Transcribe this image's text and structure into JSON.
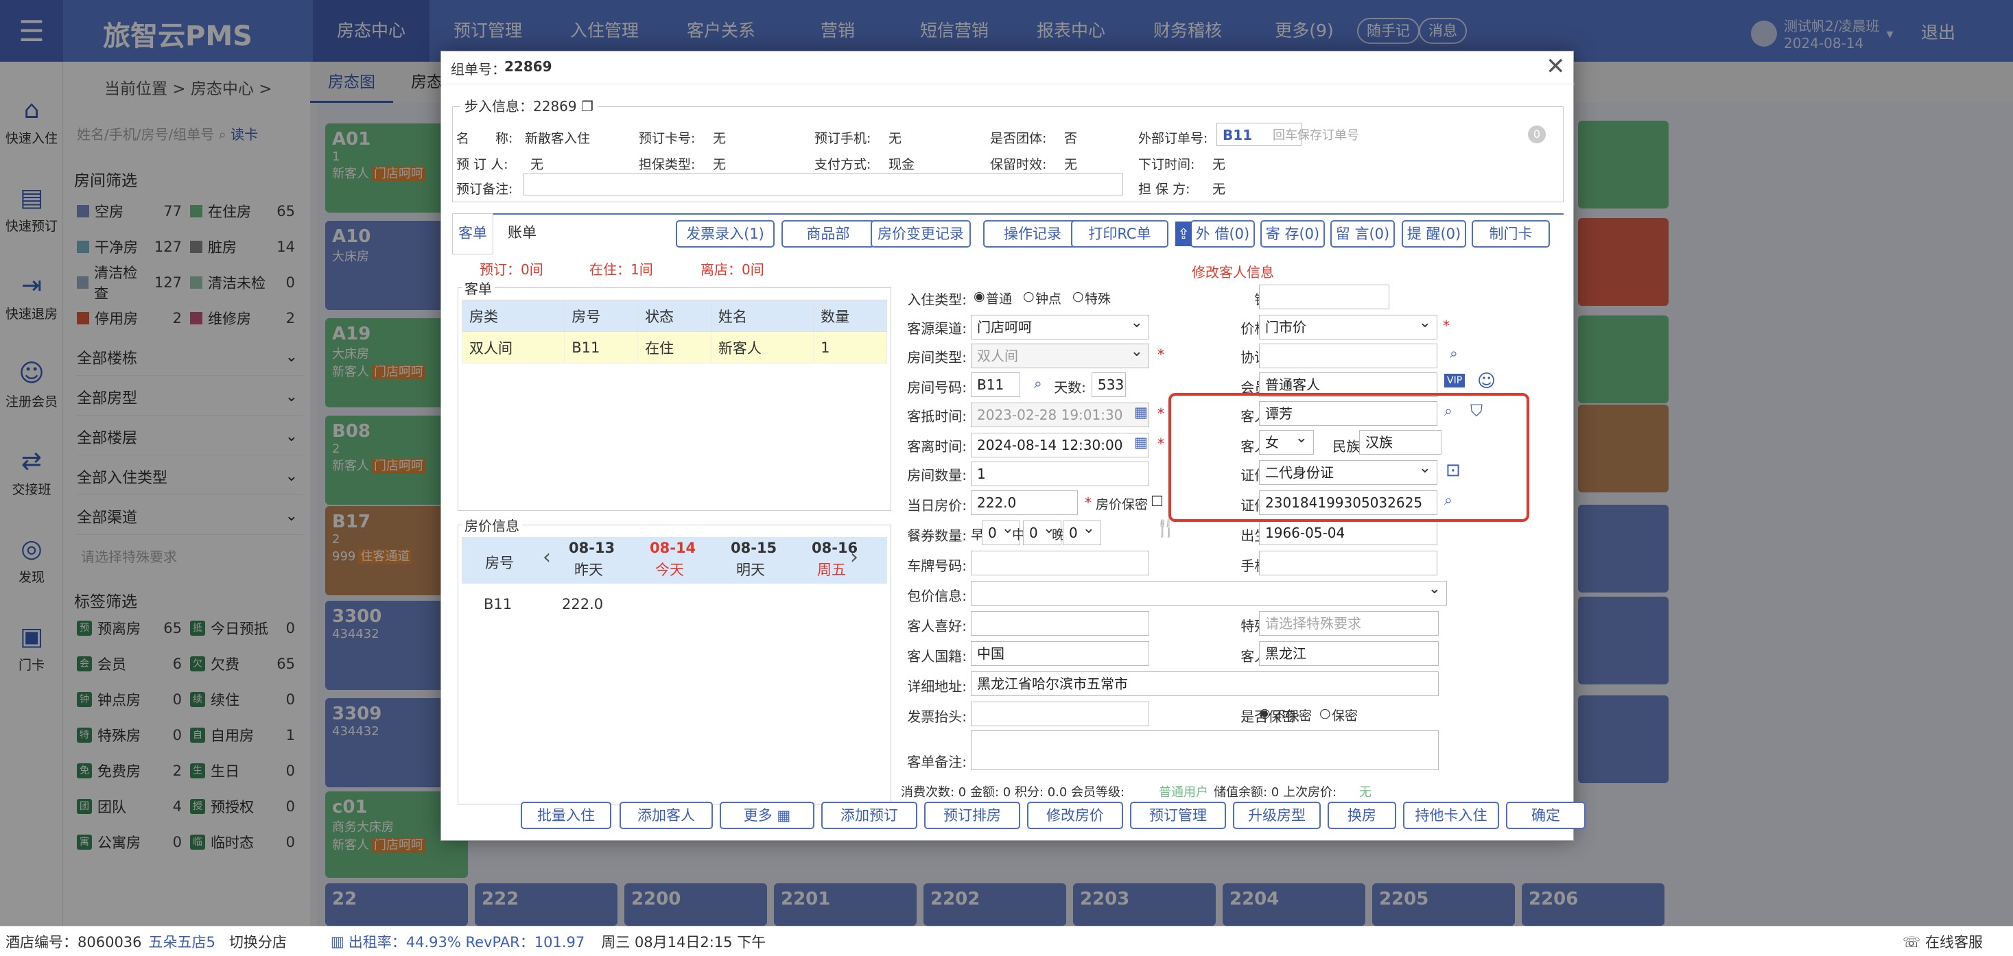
{
  "topbar": {
    "logo": "旅智云PMS",
    "nav": [
      "房态中心",
      "预订管理",
      "入住管理",
      "客户关系",
      "营销",
      "短信营销",
      "报表中心",
      "财务稽核",
      "更多(9)"
    ],
    "pill_note": "随手记",
    "pill_msg": "消息",
    "user_name": "测试帆2/凌晨班",
    "user_date": "2024-08-14",
    "logout": "退出"
  },
  "rail": [
    {
      "icon": "home-icon",
      "label": "快速入住"
    },
    {
      "icon": "booking-icon",
      "label": "快速预订"
    },
    {
      "icon": "checkout-icon",
      "label": "快速退房"
    },
    {
      "icon": "user-add-icon",
      "label": "注册会员"
    },
    {
      "icon": "handover-icon",
      "label": "交接班"
    },
    {
      "icon": "discover-icon",
      "label": "发现"
    },
    {
      "icon": "card-icon",
      "label": "门卡"
    }
  ],
  "breadcrumb": "当前位置 > 房态中心 >",
  "tabs": [
    "房态图",
    "房态"
  ],
  "side": {
    "search_placeholder": "姓名/手机/房号/组单号",
    "read_card": "读卡",
    "room_filter_title": "房间筛选",
    "room_filters": [
      [
        "空房",
        "77",
        "在住房",
        "65"
      ],
      [
        "干净房",
        "127",
        "脏房",
        "14"
      ],
      [
        "清洁检查",
        "127",
        "清洁未检",
        "0"
      ],
      [
        "停用房",
        "2",
        "维修房",
        "2"
      ]
    ],
    "dropdowns": [
      "全部楼栋",
      "全部房型",
      "全部楼层",
      "全部入住类型",
      "全部渠道"
    ],
    "special_placeholder": "请选择特殊要求",
    "tag_title": "标签筛选",
    "tags": [
      [
        "预",
        "预离房",
        "65",
        "抵",
        "今日预抵",
        "0"
      ],
      [
        "会",
        "会员",
        "6",
        "欠",
        "欠费",
        "65"
      ],
      [
        "钟",
        "钟点房",
        "0",
        "续",
        "续住",
        "0"
      ],
      [
        "特",
        "特殊房",
        "0",
        "自",
        "自用房",
        "1"
      ],
      [
        "免",
        "免费房",
        "2",
        "生",
        "生日",
        "0"
      ],
      [
        "团",
        "团队",
        "4",
        "授",
        "预授权",
        "0"
      ],
      [
        "寓",
        "公寓房",
        "0",
        "临",
        "临时态",
        "0"
      ]
    ]
  },
  "cards": [
    {
      "no": "A01",
      "l1": "1",
      "l2": "新客人",
      "tag": "门店呵呵",
      "c": "#6fbf86"
    },
    {
      "no": "A10",
      "l1": "大床房",
      "l2": "",
      "tag": "",
      "c": "#6f86c8"
    },
    {
      "no": "A19",
      "l1": "大床房",
      "l2": "新客人",
      "tag": "门店呵呵",
      "c": "#6fbf86"
    },
    {
      "no": "B08",
      "l1": "2",
      "l2": "新客人",
      "tag": "门店呵呵",
      "c": "#6fbf86"
    },
    {
      "no": "B17",
      "l1": "2",
      "l2": "999",
      "tag": "住客通道",
      "c": "#c28a5a"
    },
    {
      "no": "3300",
      "l1": "434432",
      "l2": "",
      "tag": "",
      "c": "#6f86c8"
    },
    {
      "no": "3309",
      "l1": "434432",
      "l2": "",
      "tag": "",
      "c": "#6f86c8"
    },
    {
      "no": "c01",
      "l1": "商务大床房",
      "l2": "新客人",
      "tag": "门店呵呵",
      "c": "#6fbf86"
    }
  ],
  "bottom_cards": [
    "22",
    "222",
    "2200",
    "2201",
    "2202",
    "2203",
    "2204",
    "2205",
    "2206"
  ],
  "statusbar": {
    "hotel_code": "酒店编号：8060036",
    "hotel_name": "五朵五店5",
    "switch": "切换分店",
    "occupancy": "出租率：44.93% RevPAR：101.97",
    "datetime": "周三 08月14日2:15 下午",
    "service": "在线客服"
  },
  "modal": {
    "group_no_label": "组单号：",
    "group_no": "22869",
    "step_title": "步入信息：22869",
    "info": [
      [
        "名　　称:",
        "新散客入住"
      ],
      [
        "预订卡号:",
        "无"
      ],
      [
        "预订手机:",
        "无"
      ],
      [
        "是否团体:",
        "否"
      ],
      [
        "外部订单号:",
        "B11"
      ],
      [
        "预 订 人:",
        "无"
      ],
      [
        "担保类型:",
        "无"
      ],
      [
        "支付方式:",
        "现金"
      ],
      [
        "保留时效:",
        "无"
      ],
      [
        "下订时间:",
        "无"
      ],
      [
        "预订备注:",
        ""
      ],
      [
        "担 保 方:",
        "无"
      ]
    ],
    "ext_placeholder": "回车保存订单号",
    "ext_count": "0",
    "subtabs": [
      "客单",
      "账单"
    ],
    "actions": [
      "发票录入(1)",
      "商品部",
      "房价变更记录",
      "操作记录",
      "打印RC单",
      "外 借(0)",
      "寄 存(0)",
      "留 言(0)",
      "提 醒(0)",
      "制门卡"
    ],
    "counts": [
      "预订：0间",
      "在住：1间",
      "离店：0间"
    ],
    "edit_title": "修改客人信息",
    "order_legend": "客单",
    "order_headers": [
      "房类",
      "房号",
      "状态",
      "姓名",
      "数量"
    ],
    "order_row": [
      "双人间",
      "B11",
      "在住",
      "新客人",
      "1"
    ],
    "price_legend": "房价信息",
    "price_room_header": "房号",
    "price_days": [
      [
        "08-13",
        "昨天"
      ],
      [
        "08-14",
        "今天"
      ],
      [
        "08-15",
        "明天"
      ],
      [
        "08-16",
        "周五"
      ]
    ],
    "price_row": [
      "B11",
      "222.0"
    ],
    "form": {
      "checkin_type_label": "入住类型:",
      "checkin_types": [
        "普通",
        "钟点",
        "特殊"
      ],
      "sales_label": "销售员:",
      "source_label": "客源渠道:",
      "source": "门店呵呵",
      "price_plan_label": "价格方案:",
      "price_plan": "门市价",
      "room_type_label": "房间类型:",
      "room_type": "双人间",
      "agreement_label": "协议单位:",
      "room_no_label": "房间号码:",
      "room_no": "B11",
      "days_label": "天数:",
      "days": "533",
      "member_label": "会员卡号:",
      "member": "普通客人",
      "vip": "VIP",
      "arrive_label": "客抵时间:",
      "arrive": "2023-02-28 19:01:30",
      "guest_name_label": "客人名称:",
      "guest_name": "谭芳",
      "depart_label": "客离时间:",
      "depart": "2024-08-14 12:30:00",
      "gender_label": "客人性别:",
      "gender": "女",
      "ethnic_label": "民族:",
      "ethnic": "汉族",
      "room_count_label": "房间数量:",
      "room_count": "1",
      "id_type_label": "证件类型:",
      "id_type": "二代身份证",
      "day_price_label": "当日房价:",
      "day_price": "222.0",
      "price_secret": "房价保密",
      "id_no_label": "证件号码:",
      "id_no": "230184199305032625",
      "meal_label": "餐券数量:",
      "meal_b": "早",
      "meal_l": "中",
      "meal_d": "晚",
      "meal_val": "0",
      "birth_label": "出生日期:",
      "birth": "1966-05-04",
      "plate_label": "车牌号码:",
      "phone_label": "手机号码:",
      "package_label": "包价信息:",
      "pref_label": "客人喜好:",
      "special_label": "特殊要求:",
      "special_placeholder": "请选择特殊要求",
      "nation_label": "客人国籍:",
      "nation": "中国",
      "native_label": "客人籍贯:",
      "native": "黑龙江",
      "address_label": "详细地址:",
      "address": "黑龙江省哈尔滨市五常市",
      "invoice_label": "发票抬头:",
      "secret_label": "是否保密:",
      "secret_opts": [
        "不保密",
        "保密"
      ],
      "remark_label": "客单备注:",
      "consume": "消费次数: 0 金额: 0 积分: 0.0 会员等级:",
      "level": "普通用户",
      "consume2": "储值余额: 0 上次房价:",
      "last_price": "无"
    },
    "footer": [
      "批量入住",
      "添加客人",
      "更多",
      "添加预订",
      "预订排房",
      "修改房价",
      "预订管理",
      "升级房型",
      "换房",
      "持他卡入住",
      "确定"
    ]
  },
  "colors": {
    "primary": "#5b7ad0",
    "accent": "#3a5db8",
    "alert": "#e0392b"
  }
}
